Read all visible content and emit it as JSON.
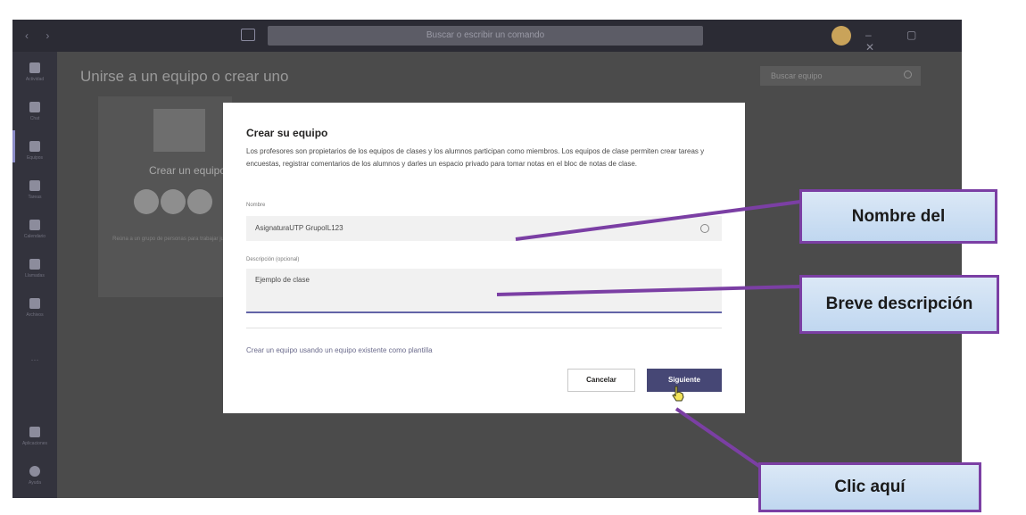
{
  "titlebar": {
    "nav_arrows": "‹ ›",
    "search_placeholder": "Buscar o escribir un comando",
    "window_controls": "– ▢ ✕"
  },
  "rail": {
    "items": [
      {
        "icon": "bell-icon",
        "label": "Actividad"
      },
      {
        "icon": "chat-icon",
        "label": "Chat"
      },
      {
        "icon": "teams-icon",
        "label": "Equipos"
      },
      {
        "icon": "assignments-icon",
        "label": "Tareas"
      },
      {
        "icon": "calendar-icon",
        "label": "Calendario"
      },
      {
        "icon": "phone-icon",
        "label": "Llamadas"
      },
      {
        "icon": "files-icon",
        "label": "Archivos"
      }
    ],
    "more": "···",
    "bottom_items": [
      {
        "icon": "apps-icon",
        "label": "Aplicaciones"
      },
      {
        "icon": "help-icon",
        "label": "Ayuda"
      }
    ]
  },
  "main": {
    "page_title": "Unirse a un equipo o crear uno",
    "team_search_placeholder": "Buscar equipo",
    "create_card": {
      "label": "Crear un equipo",
      "description": "Reúna a un grupo de personas para trabajar juntos."
    }
  },
  "dialog": {
    "title": "Crear su equipo",
    "description": "Los profesores son propietarios de los equipos de clases y los alumnos participan como miembros. Los equipos de clase permiten crear tareas y encuestas, registrar comentarios de los alumnos y darles un espacio privado para tomar notas en el bloc de notas de clase.",
    "name_label": "Nombre",
    "name_value": "AsignaturaUTP GrupoIL123",
    "desc_label": "Descripción (opcional)",
    "desc_value": "Ejemplo de clase",
    "template_link": "Crear un equipo usando un equipo existente como plantilla",
    "cancel_label": "Cancelar",
    "next_label": "Siguiente"
  },
  "annotations": {
    "nombre": "Nombre del",
    "breve": "Breve descripción",
    "clic": "Clic aquí",
    "arrow_color": "#7b3fa4"
  },
  "colors": {
    "accent": "#464775",
    "focus_underline": "#6264a7",
    "callout_border": "#7b3fa4"
  }
}
